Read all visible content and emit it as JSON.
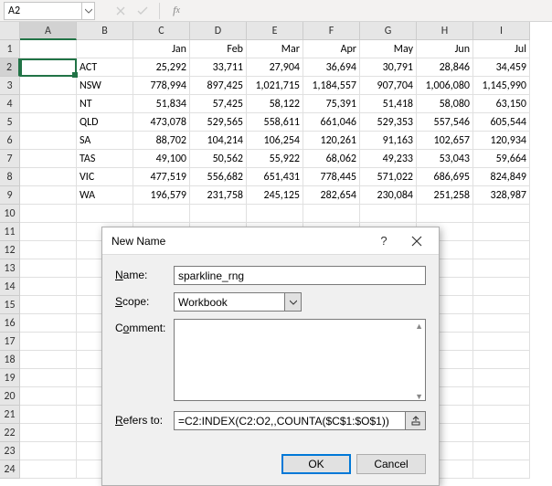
{
  "namebox": {
    "value": "A2"
  },
  "formula_bar": {
    "value": ""
  },
  "columns": [
    "A",
    "B",
    "C",
    "D",
    "E",
    "F",
    "G",
    "H",
    "I"
  ],
  "active_col": "A",
  "active_row": 2,
  "row_count": 24,
  "months": [
    "Jan",
    "Feb",
    "Mar",
    "Apr",
    "May",
    "Jun",
    "Jul"
  ],
  "rows": [
    {
      "state": "ACT",
      "vals": [
        "25,292",
        "33,711",
        "27,904",
        "36,694",
        "30,791",
        "28,846",
        "34,459"
      ]
    },
    {
      "state": "NSW",
      "vals": [
        "778,994",
        "897,425",
        "1,021,715",
        "1,184,557",
        "907,704",
        "1,006,080",
        "1,145,990"
      ]
    },
    {
      "state": "NT",
      "vals": [
        "51,834",
        "57,425",
        "58,122",
        "75,391",
        "51,418",
        "58,080",
        "63,150"
      ]
    },
    {
      "state": "QLD",
      "vals": [
        "473,078",
        "529,565",
        "558,611",
        "661,046",
        "529,353",
        "557,546",
        "605,544"
      ]
    },
    {
      "state": "SA",
      "vals": [
        "88,702",
        "104,214",
        "106,254",
        "120,261",
        "91,163",
        "102,657",
        "120,934"
      ]
    },
    {
      "state": "TAS",
      "vals": [
        "49,100",
        "50,562",
        "55,922",
        "68,062",
        "49,233",
        "53,043",
        "59,664"
      ]
    },
    {
      "state": "VIC",
      "vals": [
        "477,519",
        "556,682",
        "651,431",
        "778,445",
        "571,022",
        "686,695",
        "824,849"
      ]
    },
    {
      "state": "WA",
      "vals": [
        "196,579",
        "231,758",
        "245,125",
        "282,654",
        "230,084",
        "251,258",
        "328,987"
      ]
    }
  ],
  "dialog": {
    "title": "New Name",
    "name_label": "Name:",
    "name_value": "sparkline_rng",
    "scope_label": "Scope:",
    "scope_value": "Workbook",
    "comment_label": "Comment:",
    "comment_value": "",
    "refers_label": "Refers to:",
    "refers_value": "=C2:INDEX(C2:O2,,COUNTA($C$1:$O$1))",
    "ok": "OK",
    "cancel": "Cancel"
  }
}
